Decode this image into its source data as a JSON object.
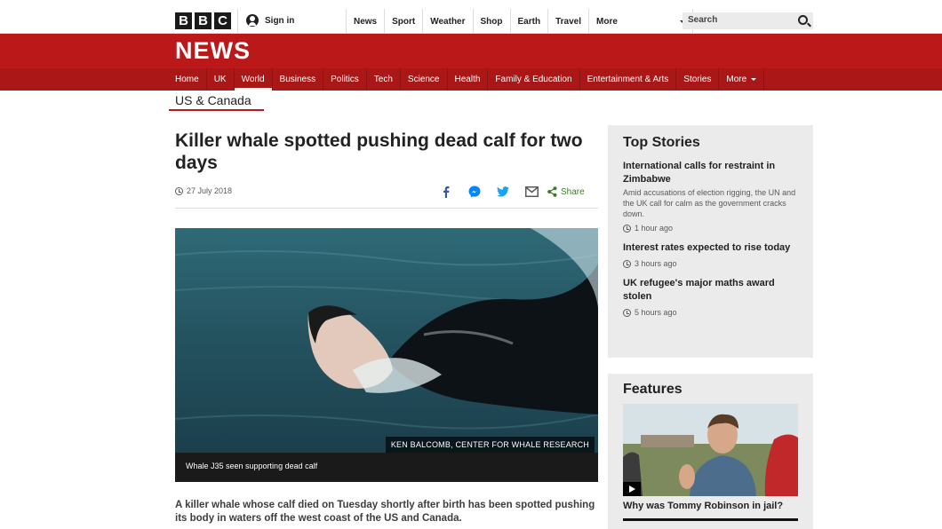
{
  "masthead": {
    "logo_letters": [
      "B",
      "B",
      "C"
    ],
    "sign_in": "Sign in",
    "nav": [
      "News",
      "Sport",
      "Weather",
      "Shop",
      "Earth",
      "Travel"
    ],
    "more": "More",
    "search_placeholder": "Search"
  },
  "news_logo": "NEWS",
  "section_nav": [
    "Home",
    "UK",
    "World",
    "Business",
    "Politics",
    "Tech",
    "Science",
    "Health",
    "Family & Education",
    "Entertainment & Arts",
    "Stories"
  ],
  "section_more": "More",
  "active_section": "World",
  "subsection": "US & Canada",
  "article": {
    "headline": "Killer whale spotted pushing dead calf for two days",
    "date": "27 July 2018",
    "share_label": "Share",
    "image_credit": "KEN BALCOMB, CENTER FOR WHALE RESEARCH",
    "caption": "Whale J35 seen supporting dead calf",
    "lede": "A killer whale whose calf died on Tuesday shortly after birth has been spotted pushing its body in waters off the west coast of the US and Canada."
  },
  "top_stories": {
    "title": "Top Stories",
    "items": [
      {
        "headline": "International calls for restraint in Zimbabwe",
        "summary": "Amid accusations of election rigging, the UN and the UK call for calm as the government cracks down.",
        "time": "1 hour ago"
      },
      {
        "headline": "Interest rates expected to rise today",
        "summary": "",
        "time": "3 hours ago"
      },
      {
        "headline": "UK refugee's major maths award stolen",
        "summary": "",
        "time": "5 hours ago"
      }
    ]
  },
  "features": {
    "title": "Features",
    "items": [
      {
        "headline": "Why was Tommy Robinson in jail?"
      }
    ]
  },
  "colors": {
    "brand_red": "#bb1919",
    "nav_red": "#a91717",
    "share_green": "#407a2d"
  }
}
